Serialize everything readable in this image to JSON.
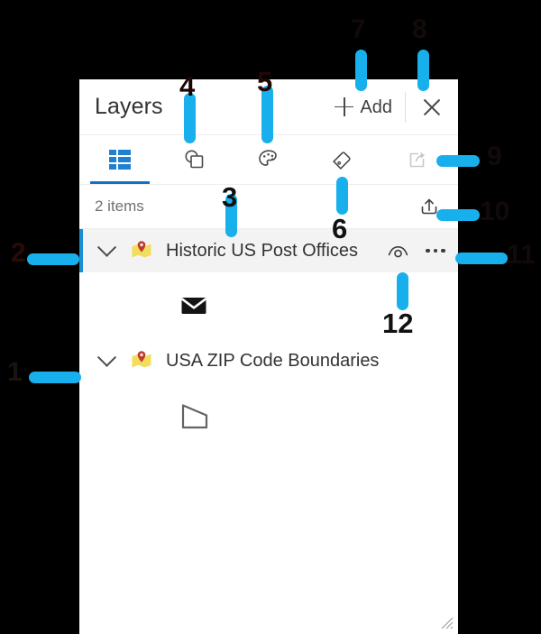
{
  "panel": {
    "title": "Layers",
    "header": {
      "add_label": "Add",
      "add_icon": "plus-icon",
      "close_icon": "close-icon"
    },
    "tabs": [
      {
        "id": "layers",
        "icon": "list-icon",
        "active": true,
        "enabled": true
      },
      {
        "id": "basemap",
        "icon": "shapes-icon",
        "active": false,
        "enabled": true
      },
      {
        "id": "styles",
        "icon": "palette-icon",
        "active": false,
        "enabled": true
      },
      {
        "id": "labels",
        "icon": "tag-icon",
        "active": false,
        "enabled": true
      },
      {
        "id": "share",
        "icon": "share-icon",
        "active": false,
        "enabled": false
      }
    ],
    "subbar": {
      "count_label": "2 items",
      "export_icon": "upload-icon"
    },
    "layers": [
      {
        "name": "Historic US Post Offices",
        "expand_icon": "chevron-down-icon",
        "type_icon": "map-pin-layer-icon",
        "visibility_icon": "eye-icon",
        "options_icon": "more-options-icon",
        "selected": true,
        "legend_symbol": "envelope-icon"
      },
      {
        "name": "USA ZIP Code Boundaries",
        "expand_icon": "chevron-down-icon",
        "type_icon": "map-pin-layer-icon",
        "selected": false,
        "legend_symbol": "polygon-outline-icon"
      }
    ],
    "resize_grip_icon": "resize-grip-icon"
  },
  "annotations": {
    "accent_color": "#18b0ec",
    "markers": [
      {
        "id": "1",
        "label": "1"
      },
      {
        "id": "2",
        "label": "2"
      },
      {
        "id": "3",
        "label": "3"
      },
      {
        "id": "4",
        "label": "4"
      },
      {
        "id": "5",
        "label": "5"
      },
      {
        "id": "6",
        "label": "6"
      },
      {
        "id": "7",
        "label": "7"
      },
      {
        "id": "8",
        "label": "8"
      },
      {
        "id": "9",
        "label": "9"
      },
      {
        "id": "10",
        "label": "10"
      },
      {
        "id": "11",
        "label": "11"
      },
      {
        "id": "12",
        "label": "12"
      }
    ]
  }
}
